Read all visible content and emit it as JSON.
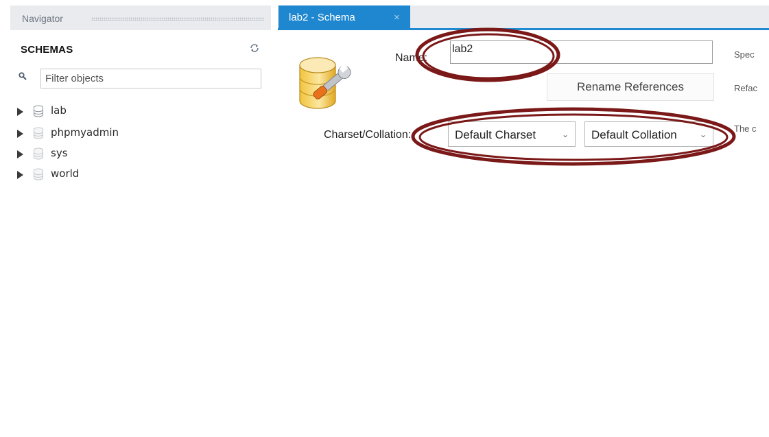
{
  "navigator": {
    "title": "Navigator",
    "schemas_heading": "SCHEMAS",
    "refresh_icon": "refresh-icon",
    "filter": {
      "placeholder": "Filter objects",
      "value": ""
    },
    "schemas": [
      {
        "name": "lab",
        "icon": "database-icon"
      },
      {
        "name": "phpmyadmin",
        "icon": "database-icon"
      },
      {
        "name": "sys",
        "icon": "database-icon"
      },
      {
        "name": "world",
        "icon": "database-icon"
      }
    ]
  },
  "editor": {
    "tab": {
      "label": "lab2 - Schema",
      "close": "×"
    },
    "name_label": "Name:",
    "name_value": "lab2",
    "rename_button": "Rename References",
    "charset_label": "Charset/Collation:",
    "charset_value": "Default Charset",
    "collation_value": "Default Collation",
    "hints": {
      "name": "Spec",
      "rename": "Refac",
      "charset": "The c"
    }
  },
  "colors": {
    "accent": "#1e87cf",
    "highlight": "#7b1818",
    "header_bg": "#e9ebef"
  }
}
